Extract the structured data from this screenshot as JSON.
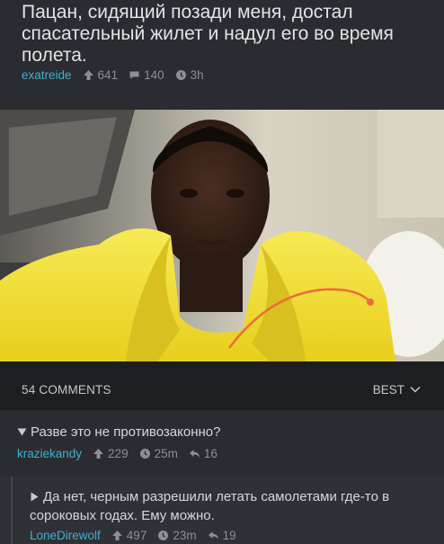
{
  "post": {
    "title": "Пацан, сидящий позади меня, достал спасательный жилет и надул его во время полета.",
    "author": "exatreide",
    "points": "641",
    "comments": "140",
    "age": "3h"
  },
  "comments_bar": {
    "count_label": "54 COMMENTS",
    "sort_label": "BEST"
  },
  "comments": [
    {
      "text": "Разве это не противозаконно?",
      "author": "kraziekandy",
      "points": "229",
      "age": "25m",
      "replies": "16"
    },
    {
      "text": "Да нет, черным разрешили летать самолетами где-то в сороковых годах. Ему можно.",
      "author": "LoneDirewolf",
      "points": "497",
      "age": "23m",
      "replies": "19"
    }
  ],
  "icons": {
    "points": "arrow-up-icon",
    "comments": "speech-bubble-icon",
    "time": "clock-icon",
    "replies": "reply-arrow-icon",
    "collapse": "triangle-down-icon",
    "expand": "triangle-right-icon",
    "sort": "chevron-down-icon"
  },
  "colors": {
    "background": "#1d1e22",
    "panel": "#2b2c31",
    "username": "#3bb1d0",
    "text": "#d6d7da",
    "muted": "#8d8f95"
  }
}
